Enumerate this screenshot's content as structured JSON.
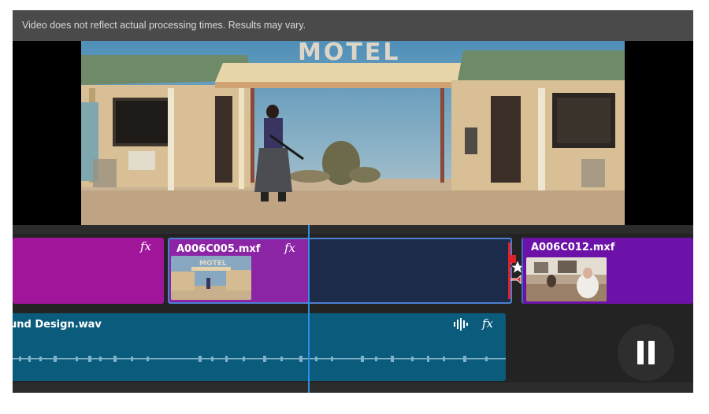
{
  "notice": {
    "text": "Video does not reflect actual processing times. Results may vary."
  },
  "preview": {
    "sign_text": "MOTEL"
  },
  "timeline": {
    "clips": [
      {
        "name": "",
        "fx": "fx",
        "color": "#a0159a"
      },
      {
        "name": "A006C005.mxf",
        "fx": "fx",
        "color": "#8c24a6",
        "selected_fill": "#1c2b4a",
        "thumb_sign": "MOTEL"
      },
      {
        "name": "A006C012.mxf",
        "fx": "",
        "color": "#6d12a8"
      }
    ],
    "audio": {
      "name": "und Design.wav",
      "fx": "fx",
      "color": "#0b5b7c"
    },
    "transition_icon": "stars-transition-icon",
    "playhead_color": "#2f8ee8"
  },
  "controls": {
    "pause_icon": "pause-icon"
  }
}
